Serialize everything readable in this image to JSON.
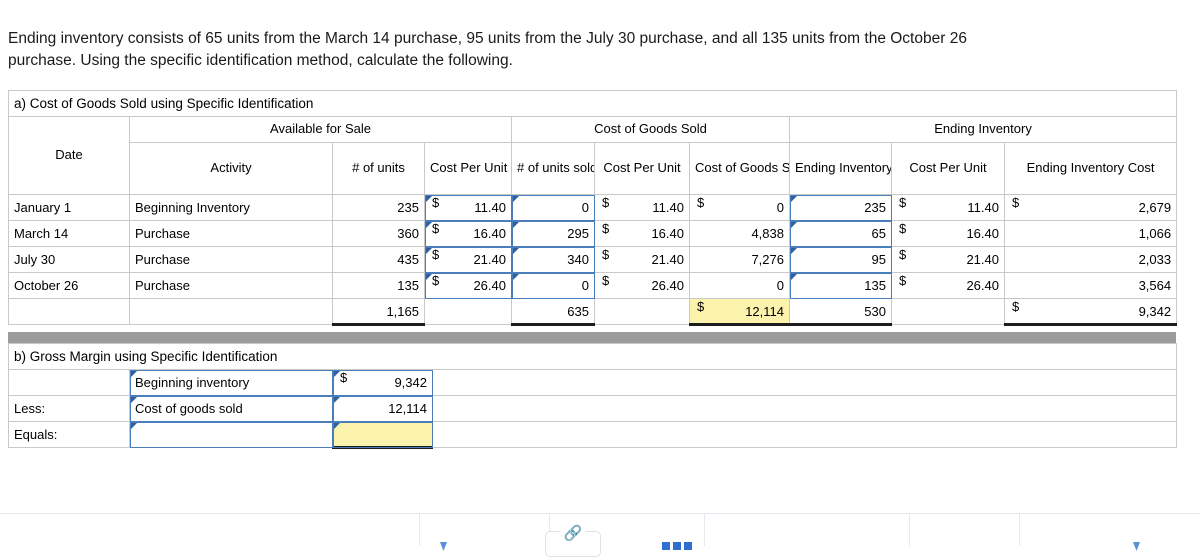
{
  "problem": {
    "text": "Ending inventory consists of 65 units from the March 14 purchase, 95 units from the July 30 purchase, and all 135 units from the October 26 purchase. Using the specific identification method, calculate the following."
  },
  "colors": {
    "header_blue": "#7ba7dd",
    "highlight_yellow": "#fbf3ab",
    "selection_blue": "#4a7ebb",
    "gray_band": "#9c9c9c"
  },
  "section_a": {
    "title": "a) Cost of Goods Sold using Specific Identification",
    "group_headers": {
      "available_for_sale": "Available for Sale",
      "cost_of_goods_sold": "Cost of Goods Sold",
      "ending_inventory": "Ending Inventory"
    },
    "columns": {
      "date": "Date",
      "activity": "Activity",
      "units_available": "# of units",
      "cost_per_unit_available": "Cost Per Unit",
      "units_sold": "# of units sold",
      "cost_per_unit_sold": "Cost Per Unit",
      "cost_of_goods_sold": "Cost of Goods Sold",
      "ending_inventory_units": "Ending Inventory Units",
      "cost_per_unit_ending": "Cost Per Unit",
      "ending_inventory_cost": "Ending Inventory Cost"
    },
    "rows": [
      {
        "date": "January 1",
        "activity": "Beginning Inventory",
        "units_available": "235",
        "cpu_available_sym": "$",
        "cpu_available": "11.40",
        "units_sold": "0",
        "cpu_sold_sym": "$",
        "cpu_sold": "11.40",
        "cogs_sym": "$",
        "cogs": "0",
        "ei_units": "235",
        "cpu_ei_sym": "$",
        "cpu_ei": "11.40",
        "ei_cost_sym": "$",
        "ei_cost": "2,679"
      },
      {
        "date": "March 14",
        "activity": "Purchase",
        "units_available": "360",
        "cpu_available_sym": "$",
        "cpu_available": "16.40",
        "units_sold": "295",
        "cpu_sold_sym": "$",
        "cpu_sold": "16.40",
        "cogs_sym": "",
        "cogs": "4,838",
        "ei_units": "65",
        "cpu_ei_sym": "$",
        "cpu_ei": "16.40",
        "ei_cost_sym": "",
        "ei_cost": "1,066"
      },
      {
        "date": "July 30",
        "activity": "Purchase",
        "units_available": "435",
        "cpu_available_sym": "$",
        "cpu_available": "21.40",
        "units_sold": "340",
        "cpu_sold_sym": "$",
        "cpu_sold": "21.40",
        "cogs_sym": "",
        "cogs": "7,276",
        "ei_units": "95",
        "cpu_ei_sym": "$",
        "cpu_ei": "21.40",
        "ei_cost_sym": "",
        "ei_cost": "2,033"
      },
      {
        "date": "October 26",
        "activity": "Purchase",
        "units_available": "135",
        "cpu_available_sym": "$",
        "cpu_available": "26.40",
        "units_sold": "0",
        "cpu_sold_sym": "$",
        "cpu_sold": "26.40",
        "cogs_sym": "",
        "cogs": "0",
        "ei_units": "135",
        "cpu_ei_sym": "$",
        "cpu_ei": "26.40",
        "ei_cost_sym": "",
        "ei_cost": "3,564"
      }
    ],
    "totals": {
      "units_available": "1,165",
      "units_sold": "635",
      "cogs_sym": "$",
      "cogs": "12,114",
      "ei_units": "530",
      "ei_cost_sym": "$",
      "ei_cost": "9,342"
    }
  },
  "section_b": {
    "title": "b) Gross Margin using Specific Identification",
    "rows": [
      {
        "label": "",
        "item": "Beginning inventory",
        "sym": "$",
        "value": "9,342"
      },
      {
        "label": "Less:",
        "item": "Cost of goods sold",
        "sym": "",
        "value": "12,114"
      },
      {
        "label": "Equals:",
        "item": "",
        "sym": "",
        "value": ""
      }
    ]
  },
  "bottom_toolbar": {
    "link_icon": "link-icon",
    "grid_icon": "grid-icon"
  }
}
